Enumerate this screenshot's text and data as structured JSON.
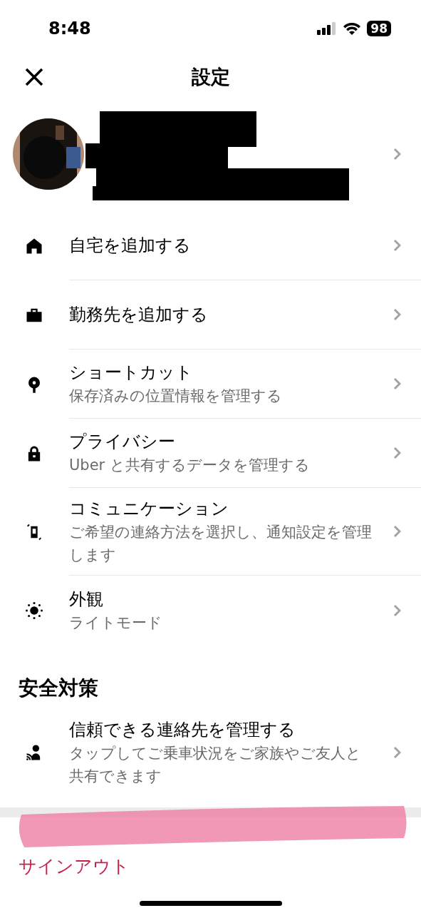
{
  "status_bar": {
    "time": "8:48",
    "battery": "98"
  },
  "header": {
    "title": "設定"
  },
  "items": [
    {
      "kind": "home",
      "title": "自宅を追加する"
    },
    {
      "kind": "briefcase",
      "title": "勤務先を追加する"
    },
    {
      "kind": "pin",
      "title": "ショートカット",
      "subtitle": "保存済みの位置情報を管理する"
    },
    {
      "kind": "lock",
      "title": "プライバシー",
      "subtitle": "Uber と共有するデータを管理する"
    },
    {
      "kind": "phone",
      "title": "コミュニケーション",
      "subtitle": "ご希望の連絡方法を選択し、通知設定を管理します"
    },
    {
      "kind": "sun",
      "title": "外観",
      "subtitle": "ライトモード"
    }
  ],
  "safety": {
    "heading": "安全対策",
    "items": [
      {
        "kind": "person-share",
        "title": "信頼できる連絡先を管理する",
        "subtitle": "タップしてご乗車状況をご家族やご友人と共有できます"
      }
    ]
  },
  "sign_out": "サインアウト"
}
